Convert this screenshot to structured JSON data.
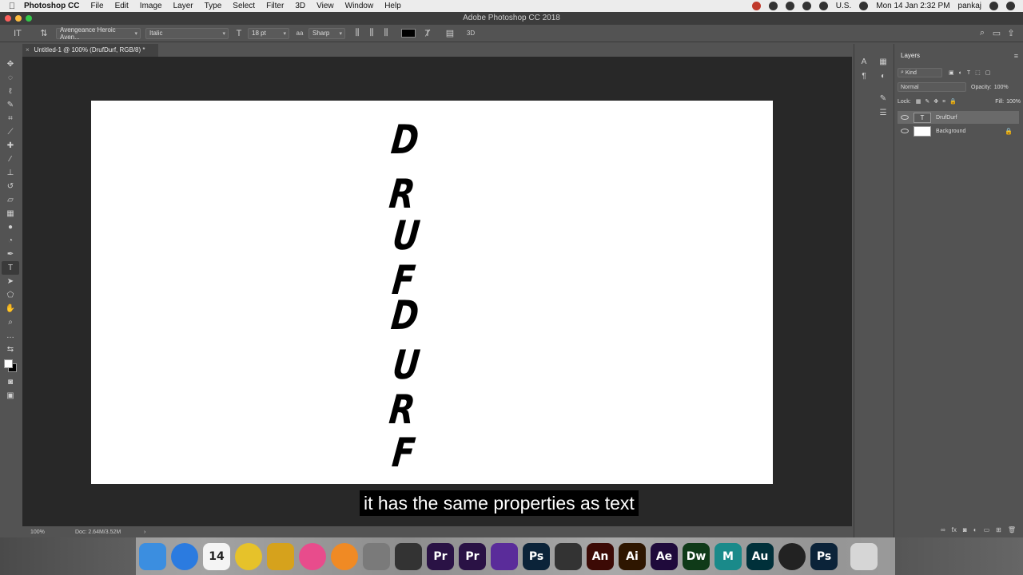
{
  "menubar": {
    "app": "Photoshop CC",
    "items": [
      "File",
      "Edit",
      "Image",
      "Layer",
      "Type",
      "Select",
      "Filter",
      "3D",
      "View",
      "Window",
      "Help"
    ],
    "input_source": "U.S.",
    "datetime": "Mon 14 Jan  2:32 PM",
    "user": "pankaj"
  },
  "window": {
    "title": "Adobe Photoshop CC 2018"
  },
  "options": {
    "font_family": "Avengeance Heroic Aven...",
    "font_style": "Italic",
    "font_size": "18 pt",
    "antialias_icon": "aa",
    "antialias": "Sharp",
    "mode_3d": "3D"
  },
  "document": {
    "tab": "Untitled-1 @ 100% (DrufDurf, RGB/8) *",
    "glyphs": [
      "D",
      "R",
      "U",
      "F",
      "D",
      "U",
      "R",
      "F"
    ]
  },
  "status": {
    "zoom": "100%",
    "doc": "Doc: 2.64M/3.52M",
    "arrow": "›"
  },
  "caption": "it has the same properties as text",
  "layers_panel": {
    "tab": "Layers",
    "filter": "Kind",
    "blend": "Normal",
    "opacity_label": "Opacity:",
    "opacity": "100%",
    "lock_label": "Lock:",
    "fill_label": "Fill:",
    "fill": "100%",
    "layers": [
      {
        "name": "DrufDurf",
        "type": "T"
      },
      {
        "name": "Background",
        "type": ""
      }
    ],
    "footer_fx": "fx"
  },
  "dock": [
    {
      "name": "finder-icon",
      "label": "",
      "color": "#3b8ee0"
    },
    {
      "name": "safari-icon",
      "label": "",
      "color": "#2b7be0"
    },
    {
      "name": "calendar-icon",
      "label": "14",
      "color": "#f4f4f4"
    },
    {
      "name": "chrome-icon",
      "label": "",
      "color": "#e6c22a"
    },
    {
      "name": "radiation-app-icon",
      "label": "",
      "color": "#d6a21c"
    },
    {
      "name": "itunes-icon",
      "label": "",
      "color": "#e84c8c"
    },
    {
      "name": "books-icon",
      "label": "",
      "color": "#f08a24"
    },
    {
      "name": "preferences-icon",
      "label": "",
      "color": "#7a7a7a"
    },
    {
      "name": "clapper-icon",
      "label": "",
      "color": "#333333"
    },
    {
      "name": "premiere-icon",
      "label": "Pr",
      "color": "#2a1245"
    },
    {
      "name": "premiere-2-icon",
      "label": "Pr",
      "color": "#2a1245"
    },
    {
      "name": "purple-app-icon",
      "label": "",
      "color": "#5a2c9a"
    },
    {
      "name": "photoshop-icon",
      "label": "Ps",
      "color": "#0b2339"
    },
    {
      "name": "final-cut-icon",
      "label": "",
      "color": "#333333"
    },
    {
      "name": "animate-icon",
      "label": "An",
      "color": "#3c0a05"
    },
    {
      "name": "illustrator-icon",
      "label": "Ai",
      "color": "#2e1600"
    },
    {
      "name": "after-effects-icon",
      "label": "Ae",
      "color": "#1f0a3b"
    },
    {
      "name": "dreamweaver-icon",
      "label": "Dw",
      "color": "#0f3a18"
    },
    {
      "name": "maya-icon",
      "label": "M",
      "color": "#1a8a8a"
    },
    {
      "name": "audition-icon",
      "label": "Au",
      "color": "#00303a"
    },
    {
      "name": "obs-icon",
      "label": "",
      "color": "#222222"
    },
    {
      "name": "photoshop-2-icon",
      "label": "Ps",
      "color": "#0b2339"
    },
    {
      "name": "trash-icon",
      "label": "",
      "color": "#cccccc"
    }
  ]
}
